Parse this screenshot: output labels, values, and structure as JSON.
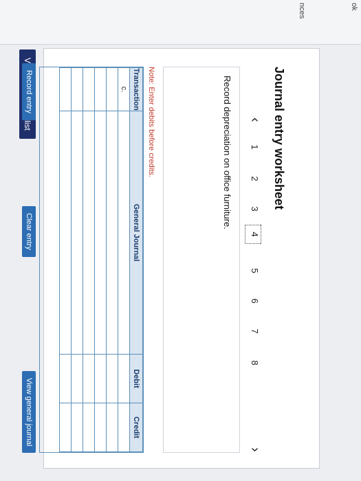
{
  "sidebar": {
    "label_ok": "ok",
    "label_ences": "nces"
  },
  "toolbar": {
    "view_transaction_list": "View transaction list"
  },
  "worksheet": {
    "title": "Journal entry worksheet",
    "pages": [
      "1",
      "2",
      "3",
      "4",
      "5",
      "6",
      "7",
      "8"
    ],
    "instruction": "Record depreciation on office furniture.",
    "note": "Note: Enter debits before credits."
  },
  "journal": {
    "headers": [
      "Transaction",
      "General Journal",
      "Debit",
      "Credit"
    ],
    "rows": [
      [
        "c.",
        "",
        "",
        ""
      ],
      [
        "",
        "",
        "",
        ""
      ],
      [
        "",
        "",
        "",
        ""
      ],
      [
        "",
        "",
        "",
        ""
      ],
      [
        "",
        "",
        "",
        ""
      ],
      [
        "",
        "",
        "",
        ""
      ]
    ]
  },
  "buttons": {
    "record_entry": "Record entry",
    "clear_entry": "Clear entry",
    "view_general_journal": "View general journal"
  },
  "icons": {
    "prev": "chevron-left-icon",
    "next": "chevron-right-icon"
  }
}
